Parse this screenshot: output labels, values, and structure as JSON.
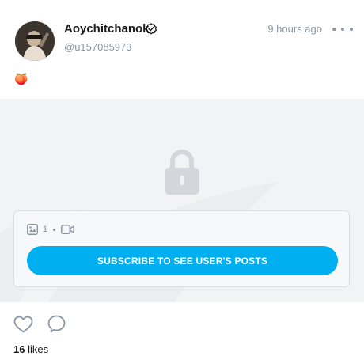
{
  "post": {
    "author": {
      "display_name": "Aoychitchanok",
      "handle": "@u157085973",
      "verified": true,
      "avatar_icon": "user-avatar-photo"
    },
    "time_ago": "9 hours ago",
    "text": "🍑",
    "locked_media": {
      "image_count": "1",
      "has_video": true,
      "subscribe_label": "SUBSCRIBE TO SEE USER'S POSTS"
    },
    "likes_count": "16",
    "likes_label": "likes"
  },
  "colors": {
    "accent": "#00aff0",
    "muted_text": "#8a96a3",
    "media_background": "#f2f3f5",
    "lock_icon": "#d3d7db"
  }
}
